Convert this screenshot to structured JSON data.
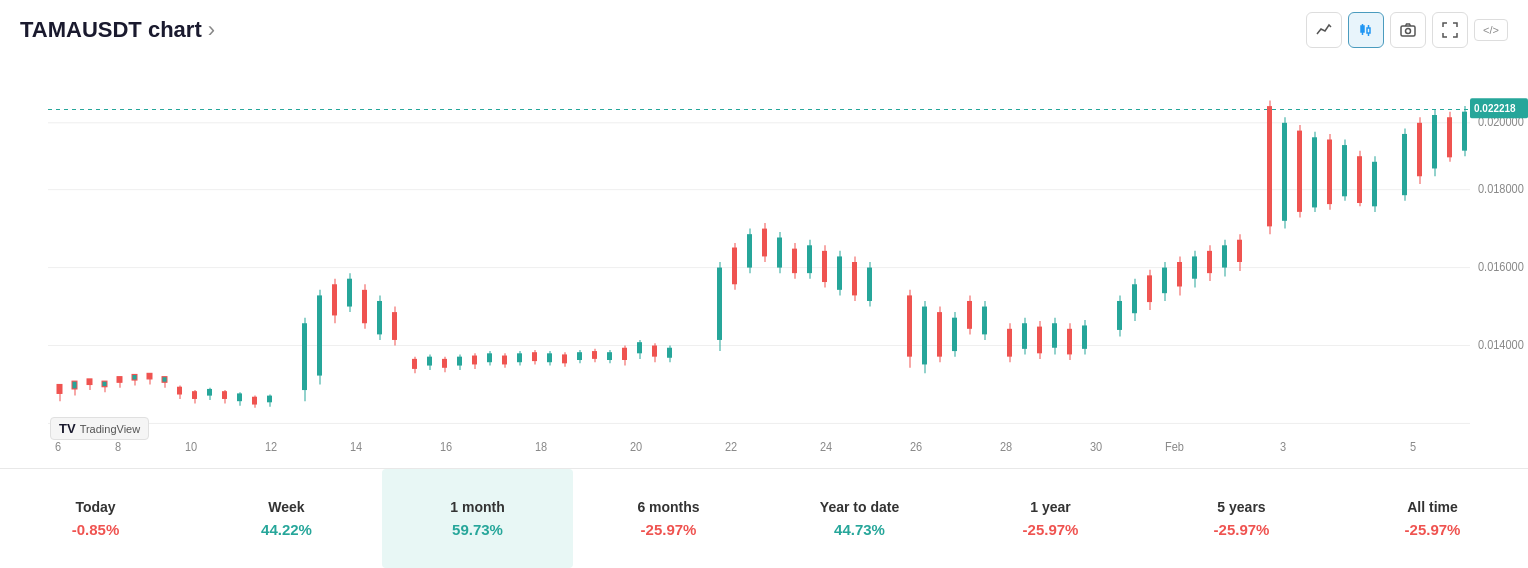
{
  "header": {
    "title": "TAMAUSDT chart",
    "arrow": "›",
    "embed_label": "</>"
  },
  "toolbar": {
    "line_icon": "line-chart-icon",
    "candle_icon": "candle-chart-icon",
    "camera_icon": "camera-icon",
    "fullscreen_icon": "fullscreen-icon"
  },
  "chart": {
    "current_price": "0.022218",
    "dashed_price_level": "0.022218",
    "y_axis_labels": [
      "0.020000",
      "0.018000",
      "0.016000",
      "0.014000"
    ],
    "x_axis_labels": [
      "6",
      "8",
      "10",
      "12",
      "14",
      "16",
      "18",
      "20",
      "22",
      "24",
      "26",
      "28",
      "30",
      "Feb",
      "3",
      "5"
    ]
  },
  "periods": [
    {
      "label": "Today",
      "value": "-0.85%",
      "color": "red",
      "active": false
    },
    {
      "label": "Week",
      "value": "44.22%",
      "color": "green",
      "active": false
    },
    {
      "label": "1 month",
      "value": "59.73%",
      "color": "green",
      "active": true
    },
    {
      "label": "6 months",
      "value": "-25.97%",
      "color": "red",
      "active": false
    },
    {
      "label": "Year to date",
      "value": "44.73%",
      "color": "green",
      "active": false
    },
    {
      "label": "1 year",
      "value": "-25.97%",
      "color": "red",
      "active": false
    },
    {
      "label": "5 years",
      "value": "-25.97%",
      "color": "red",
      "active": false
    },
    {
      "label": "All time",
      "value": "-25.97%",
      "color": "red",
      "active": false
    }
  ],
  "tradingview": {
    "logo_text": "TV",
    "label": "TradingView"
  }
}
